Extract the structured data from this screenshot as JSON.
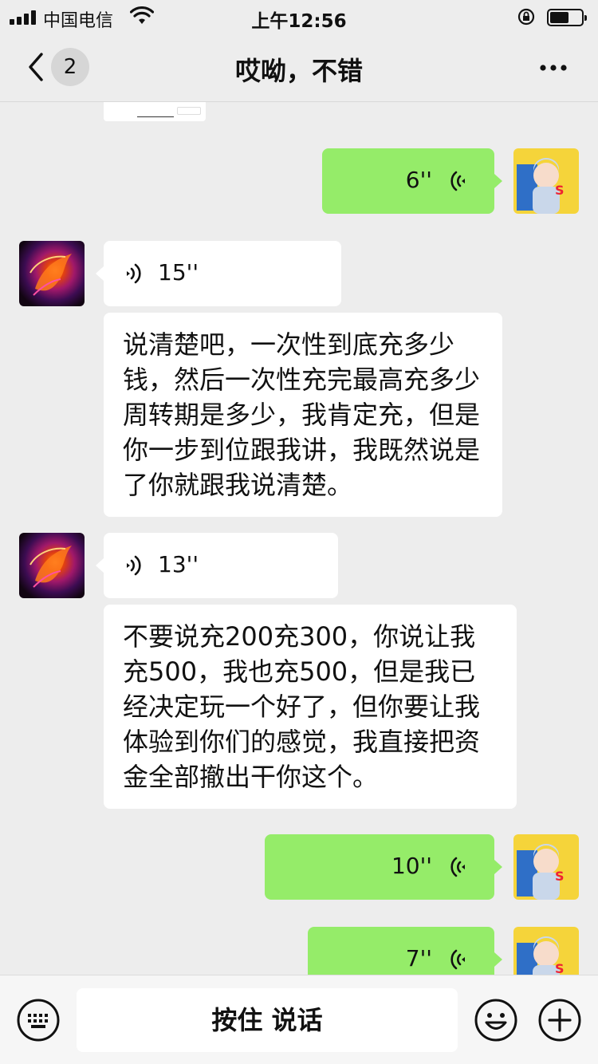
{
  "status_bar": {
    "carrier": "中国电信",
    "time": "上午12:56",
    "battery_level": 0.6
  },
  "nav": {
    "back_badge": "2",
    "title": "哎呦，不错"
  },
  "messages": [
    {
      "side": "out",
      "type": "voice",
      "duration": "6''"
    },
    {
      "side": "in",
      "type": "voice",
      "duration": "15''"
    },
    {
      "side": "in",
      "type": "text",
      "text": "说清楚吧，一次性到底充多少钱，然后一次性充完最高充多少周转期是多少，我肯定充，但是你一步到位跟我讲，我既然说是了你就跟我说清楚。"
    },
    {
      "side": "in",
      "type": "voice",
      "duration": "13''"
    },
    {
      "side": "in",
      "type": "text",
      "text": "不要说充200充300，你说让我充500，我也充500，但是我已经决定玩一个好了，但你要让我体验到你们的感觉，我直接把资金全部撤出干你这个。"
    },
    {
      "side": "out",
      "type": "voice",
      "duration": "10''"
    },
    {
      "side": "out",
      "type": "voice",
      "duration": "7''"
    }
  ],
  "input_bar": {
    "hold_to_talk": "按住 说话"
  },
  "icons": {
    "keyboard": "keyboard-icon",
    "emoji": "emoji-icon",
    "plus": "plus-icon",
    "voice_wave": "voice-wave-icon"
  },
  "colors": {
    "background": "#ededed",
    "outgoing_bubble": "#95ec69",
    "incoming_bubble": "#ffffff"
  }
}
